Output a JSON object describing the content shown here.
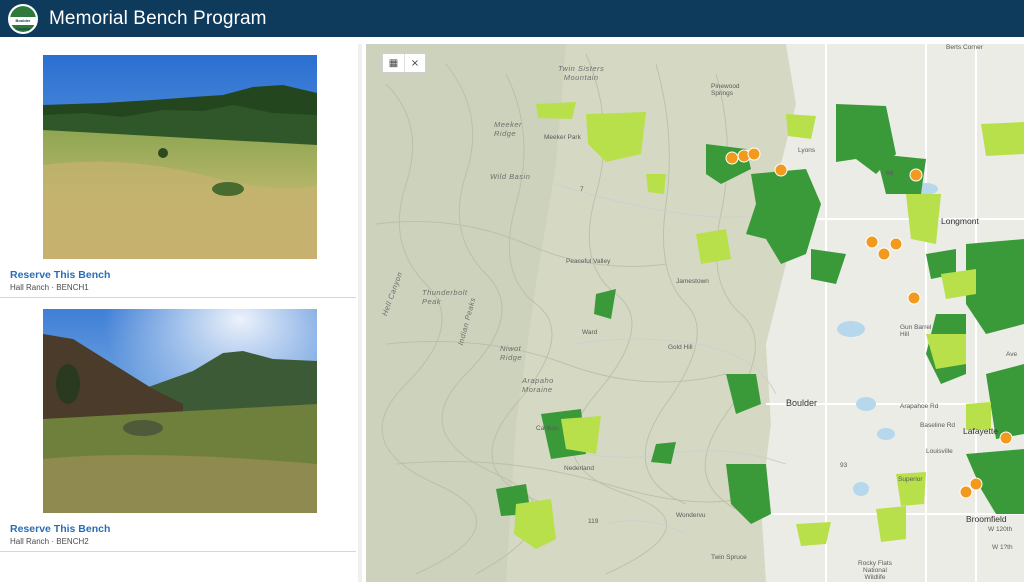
{
  "app": {
    "title": "Memorial Bench Program",
    "logo_text": "Boulder County",
    "logo_icon": "county-logo-icon"
  },
  "benches": [
    {
      "link": "Reserve This Bench",
      "subtitle": "Hall Ranch · BENCH1"
    },
    {
      "link": "Reserve This Bench",
      "subtitle": "Hall Ranch · BENCH2"
    }
  ],
  "map": {
    "tools": [
      {
        "icon": "basemap-gallery-icon",
        "glyph": "▦"
      },
      {
        "icon": "close-icon",
        "glyph": "×"
      }
    ],
    "colors": {
      "open_space_dark": "#3a9a3a",
      "open_space_light": "#b8e04a",
      "marker": "#f29a1e",
      "water": "#b7d8ec"
    },
    "labels": {
      "twin_sisters": "Twin Sisters\nMountain",
      "meeker_ridge": "Meeker\nRidge",
      "meeker_park": "Meeker Park",
      "wild_basin": "Wild Basin",
      "pinewood_springs": "Pinewood\nSprings",
      "lyons": "Lyons",
      "berts_corner": "Berts Corner",
      "longmont": "Longmont",
      "peaceful_valley": "Peaceful Valley",
      "jamestown": "Jamestown",
      "thunderbolt_peak": "Thunderbolt\nPeak",
      "niwot_ridge": "Niwot\nRidge",
      "arapaho_moraine": "Arapaho\nMoraine",
      "ward": "Ward",
      "gold_hill": "Gold Hill",
      "boulder": "Boulder",
      "gunbarrel": "Gun Barrel\nHill",
      "nederland": "Nederland",
      "caribou": "Caribou",
      "lafayette": "Lafayette",
      "louisville": "Louisville",
      "superior": "Superior",
      "broomfield": "Broomfield",
      "wondervu": "Wondervu",
      "twin_spruce": "Twin Spruce",
      "rocky_flats": "Rocky Flats\nNational\nWildlife",
      "arapahoe_rd": "Arapahoe Rd",
      "baseline_rd": "Baseline Rd",
      "indian_peaks": "Indian Peaks",
      "hell_canyon": "Hell Canyon",
      "route_7": "7",
      "route_66": "66",
      "route_93": "93",
      "route_119": "119",
      "w_120th": "W 120th",
      "w_sth": "W 1?th",
      "ave_l": "Ave"
    }
  }
}
